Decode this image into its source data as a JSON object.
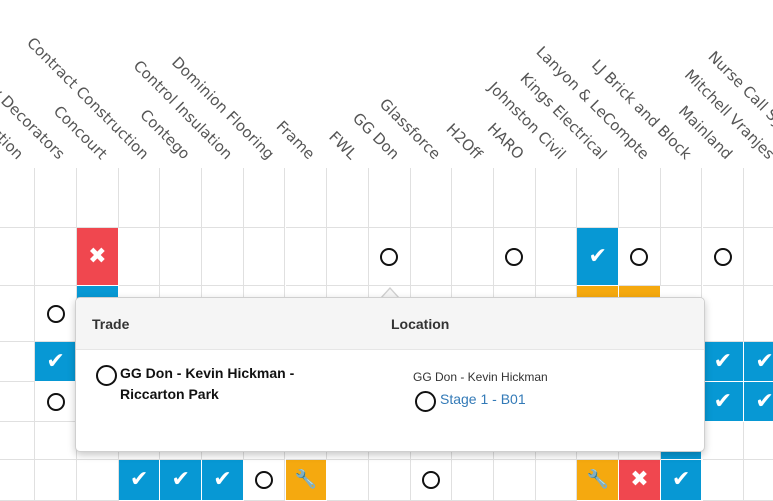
{
  "columns": [
    "Clearwater Construction",
    "Colony Decorators",
    "Concourt",
    "Contract Construction",
    "Contego",
    "Control Insulation",
    "Dominion Flooring",
    "Frame",
    "FWL",
    "GG Don",
    "Glassforce",
    "H2Off",
    "HARO",
    "Johnston Civil",
    "Kings Electrical",
    "Lanyon & LeCompte",
    "LJ Brick and Block",
    "Mainland",
    "Mitchell Vranjes",
    "Nurse Call Systems"
  ],
  "status_colors": {
    "complete": "#0798d4",
    "rejected": "#f0474f",
    "in_progress": "#f5a90f",
    "pending_ring": "#111111"
  },
  "status_icons": {
    "complete": "check-icon",
    "rejected": "x-icon",
    "in_progress": "wrench-icon",
    "pending": "empty-circle-icon"
  },
  "glyphs": {
    "complete": "✔",
    "rejected": "✖",
    "in_progress": "🔧"
  },
  "popover": {
    "trade_header": "Trade",
    "location_header": "Location",
    "trade_name": "GG Don - Kevin Hickman - Riccarton Park",
    "location_company": "GG Don - Kevin Hickman",
    "location_stage": "Stage 1 - B01"
  }
}
